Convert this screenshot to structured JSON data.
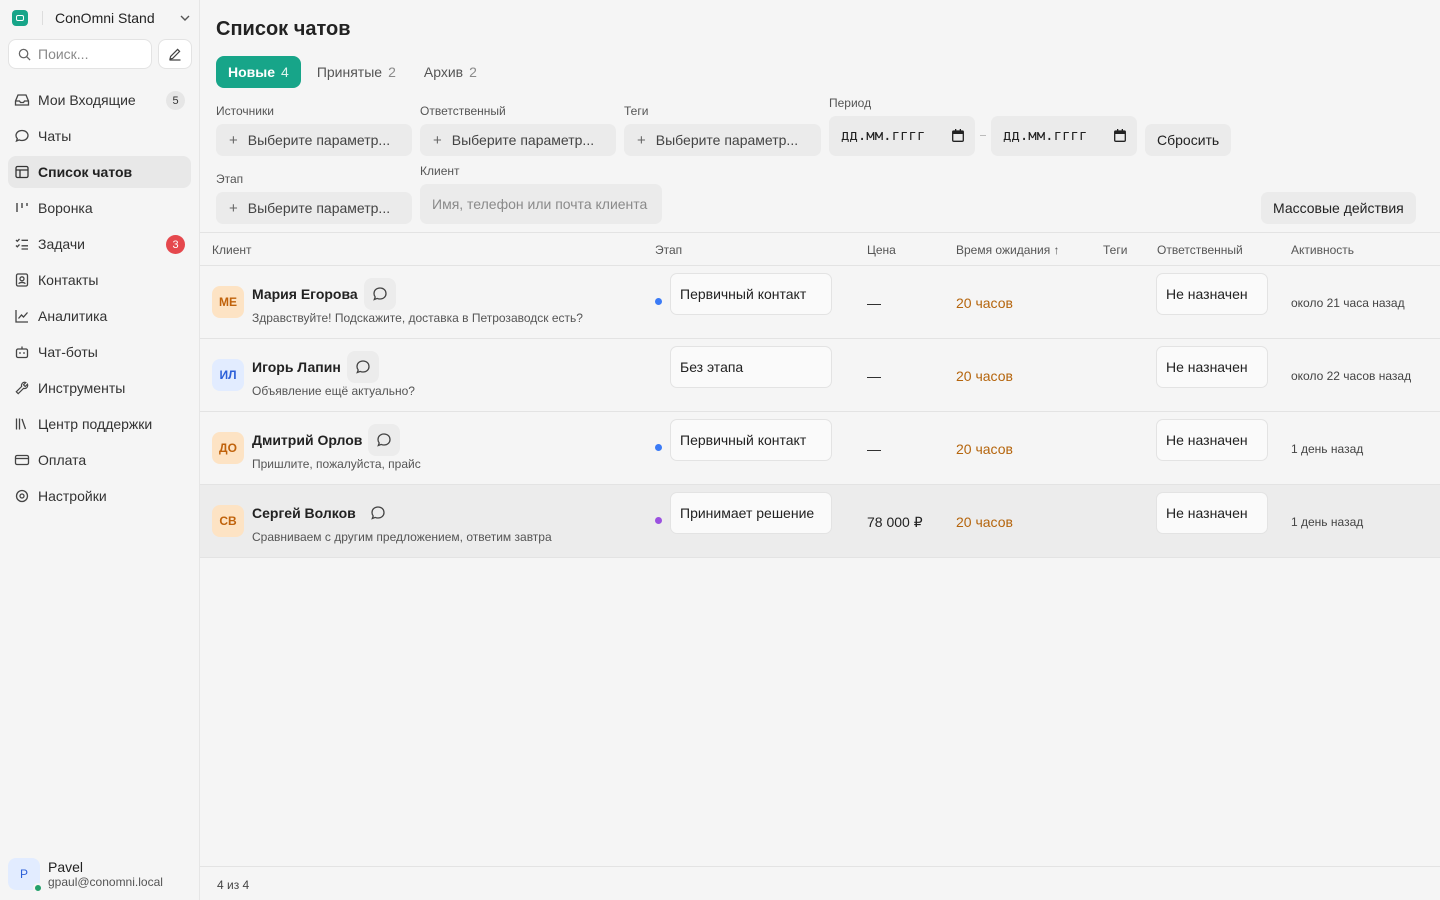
{
  "workspace": {
    "name": "ConOmni Stand"
  },
  "search": {
    "placeholder": "Поиск..."
  },
  "nav": [
    {
      "label": "Мои Входящие",
      "icon": "inbox-icon",
      "badge": "5",
      "badge_style": "gray"
    },
    {
      "label": "Чаты",
      "icon": "chat-icon"
    },
    {
      "label": "Список чатов",
      "icon": "table-icon",
      "active": true
    },
    {
      "label": "Воронка",
      "icon": "funnel-icon"
    },
    {
      "label": "Задачи",
      "icon": "tasks-icon",
      "badge": "3",
      "badge_style": "red"
    },
    {
      "label": "Контакты",
      "icon": "contacts-icon"
    },
    {
      "label": "Аналитика",
      "icon": "analytics-icon"
    },
    {
      "label": "Чат-боты",
      "icon": "bot-icon"
    },
    {
      "label": "Инструменты",
      "icon": "wrench-icon"
    },
    {
      "label": "Центр поддержки",
      "icon": "library-icon"
    },
    {
      "label": "Оплата",
      "icon": "card-icon"
    },
    {
      "label": "Настройки",
      "icon": "settings-icon"
    }
  ],
  "user": {
    "name": "Pavel",
    "email": "gpaul@conomni.local",
    "initial": "P"
  },
  "page": {
    "title": "Список чатов"
  },
  "tabs": [
    {
      "label": "Новые",
      "count": "4",
      "active": true
    },
    {
      "label": "Принятые",
      "count": "2"
    },
    {
      "label": "Архив",
      "count": "2"
    }
  ],
  "filters": {
    "sources_label": "Источники",
    "sources_placeholder": "Выберите параметр...",
    "responsible_label": "Ответственный",
    "responsible_placeholder": "Выберите параметр...",
    "tags_label": "Теги",
    "tags_placeholder": "Выберите параметр...",
    "period_label": "Период",
    "date_from": "дд.мм.гггг",
    "date_to": "дд.мм.гггг",
    "reset": "Сбросить",
    "stage_label": "Этап",
    "stage_placeholder": "Выберите параметр...",
    "client_label": "Клиент",
    "client_placeholder": "Имя, телефон или почта клиента"
  },
  "mass_actions": "Массовые действия",
  "table": {
    "headers": {
      "client": "Клиент",
      "stage": "Этап",
      "price": "Цена",
      "wait": "Время ожидания ↑",
      "tags": "Теги",
      "responsible": "Ответственный",
      "activity": "Активность"
    },
    "rows": [
      {
        "initials": "МЕ",
        "avatar_bg": "#fde3c4",
        "avatar_fg": "#c0620b",
        "name": "Мария Егорова",
        "message": "Здравствуйте! Подскажите, доставка в Петрозаводск есть?",
        "stage_color": "#3b7bf6",
        "stage": "Первичный контакт",
        "price": "—",
        "wait": "20 часов",
        "responsible": "Не назначен",
        "activity": "около 21 часа назад"
      },
      {
        "initials": "ИЛ",
        "avatar_bg": "#e2ecff",
        "avatar_fg": "#2c5fd8",
        "name": "Игорь Лапин",
        "message": "Объявление ещё актуально?",
        "stage_color": "",
        "stage": "Без этапа",
        "price": "—",
        "wait": "20 часов",
        "responsible": "Не назначен",
        "activity": "около 22 часов назад"
      },
      {
        "initials": "ДО",
        "avatar_bg": "#fde3c4",
        "avatar_fg": "#c0620b",
        "name": "Дмитрий Орлов",
        "message": "Пришлите, пожалуйста, прайс",
        "stage_color": "#3b7bf6",
        "stage": "Первичный контакт",
        "price": "—",
        "wait": "20 часов",
        "responsible": "Не назначен",
        "activity": "1 день назад"
      },
      {
        "initials": "СВ",
        "avatar_bg": "#fde3c4",
        "avatar_fg": "#c0620b",
        "name": "Сергей Волков",
        "message": "Сравниваем с другим предложением, ответим завтра",
        "stage_color": "#9b51e0",
        "stage": "Принимает решение",
        "price": "78 000 ₽",
        "wait": "20 часов",
        "responsible": "Не назначен",
        "activity": "1 день назад"
      }
    ]
  },
  "footer": {
    "count": "4 из 4"
  }
}
